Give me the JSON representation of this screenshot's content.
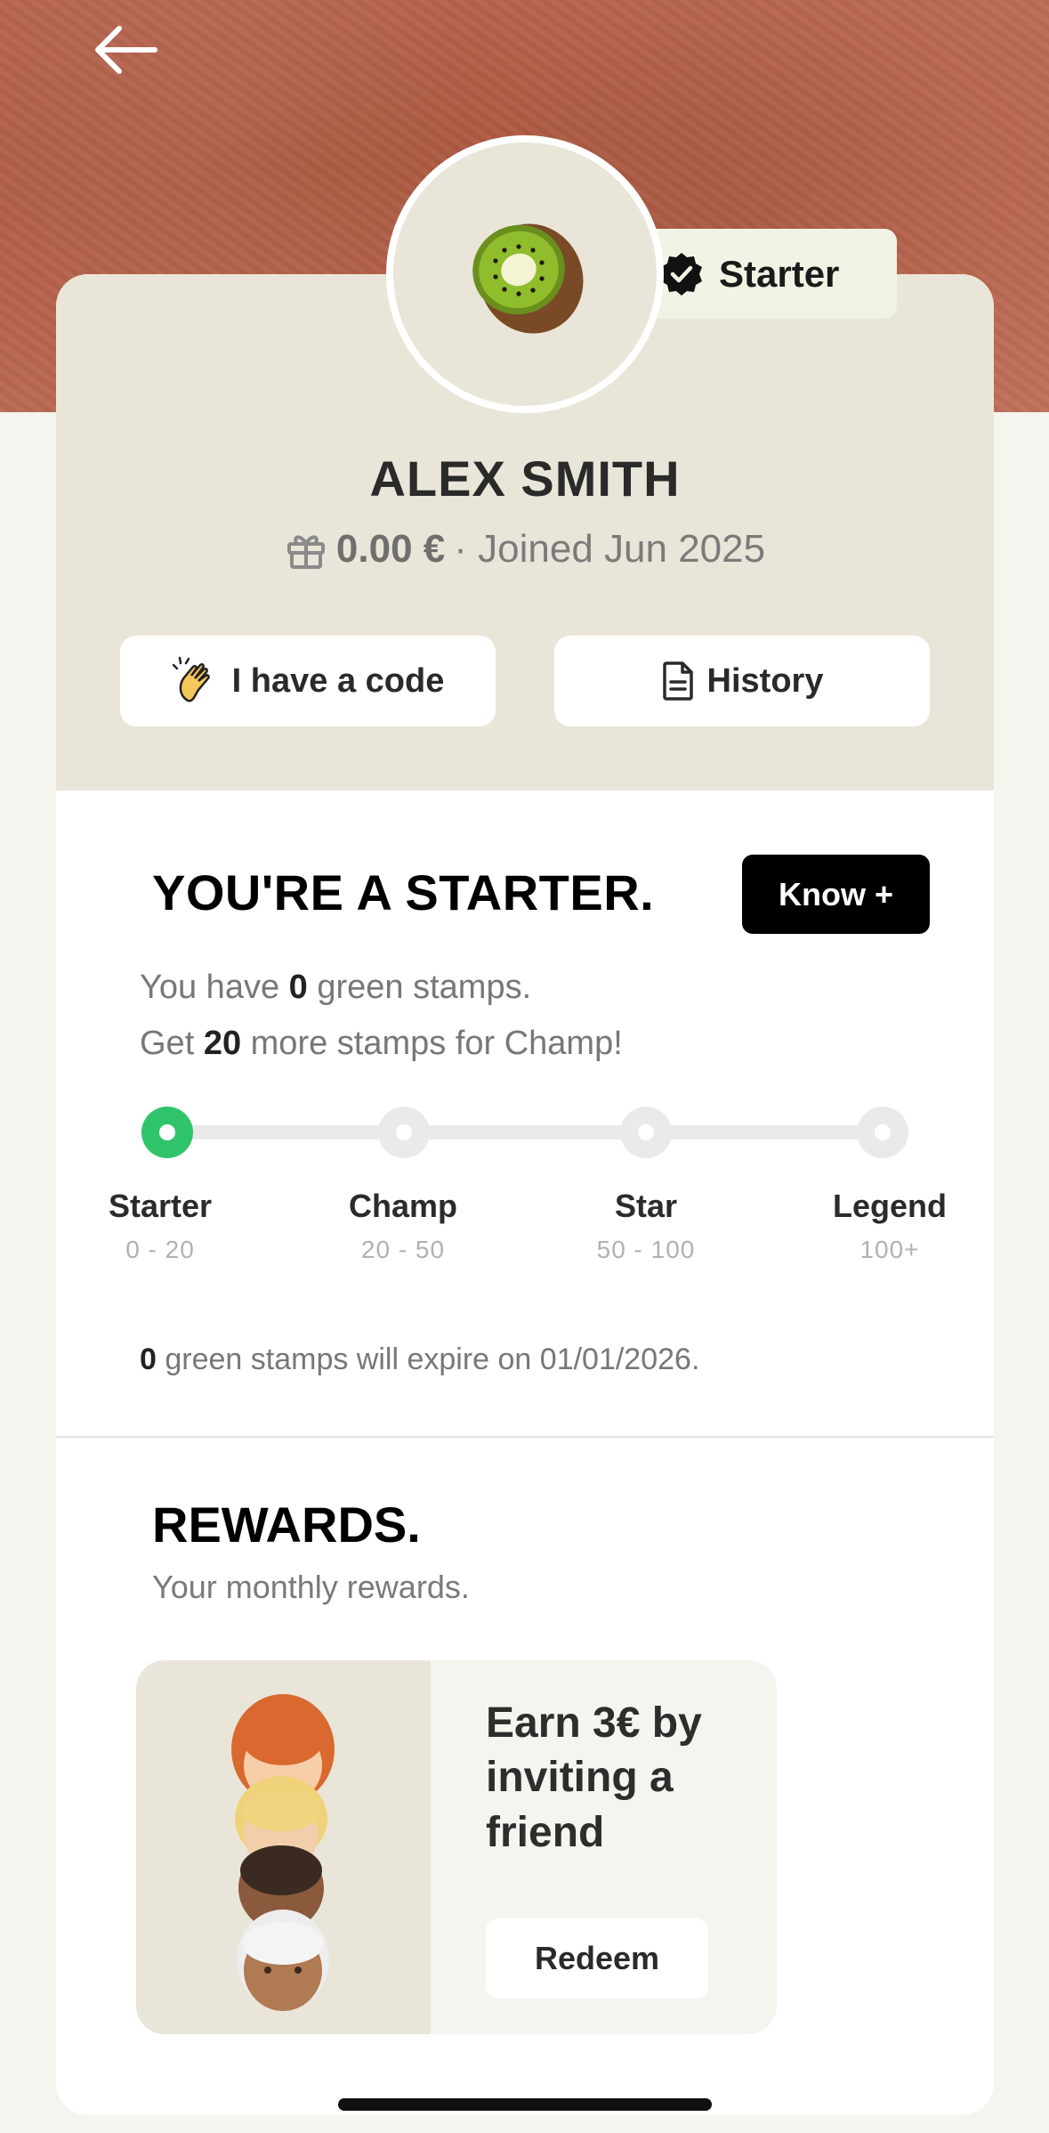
{
  "profile": {
    "tier_badge": "Starter",
    "name": "ALEX SMITH",
    "balance": "0.00 €",
    "joined": "· Joined Jun 2025",
    "code_button": "I have a code",
    "history_button": "History"
  },
  "level": {
    "title": "YOU'RE A STARTER.",
    "know_button": "Know +",
    "line1_prefix": "You have ",
    "line1_value": "0",
    "line1_suffix": " green stamps.",
    "line2_prefix": "Get ",
    "line2_value": "20",
    "line2_suffix": " more stamps for Champ!",
    "tiers": [
      {
        "name": "Starter",
        "range": "0 - 20"
      },
      {
        "name": "Champ",
        "range": "20 - 50"
      },
      {
        "name": "Star",
        "range": "50 - 100"
      },
      {
        "name": "Legend",
        "range": "100+"
      }
    ],
    "current_tier": "Starter",
    "expire_value": "0",
    "expire_text": " green stamps will expire on 01/01/2026."
  },
  "rewards": {
    "title": "REWARDS.",
    "subtitle": "Your monthly rewards.",
    "card_text": "Earn 3€ by inviting a friend",
    "redeem_button": "Redeem"
  },
  "colors": {
    "hero": "#b4604a",
    "panel": "#e9e6d9",
    "active_dot": "#2fc46a",
    "badge_bg": "#f1f4e4"
  },
  "icons": [
    "back-arrow-icon",
    "kiwi-icon",
    "verified-badge-icon",
    "gift-icon",
    "clapping-hands-icon",
    "document-icon",
    "people-emoji-icon"
  ]
}
